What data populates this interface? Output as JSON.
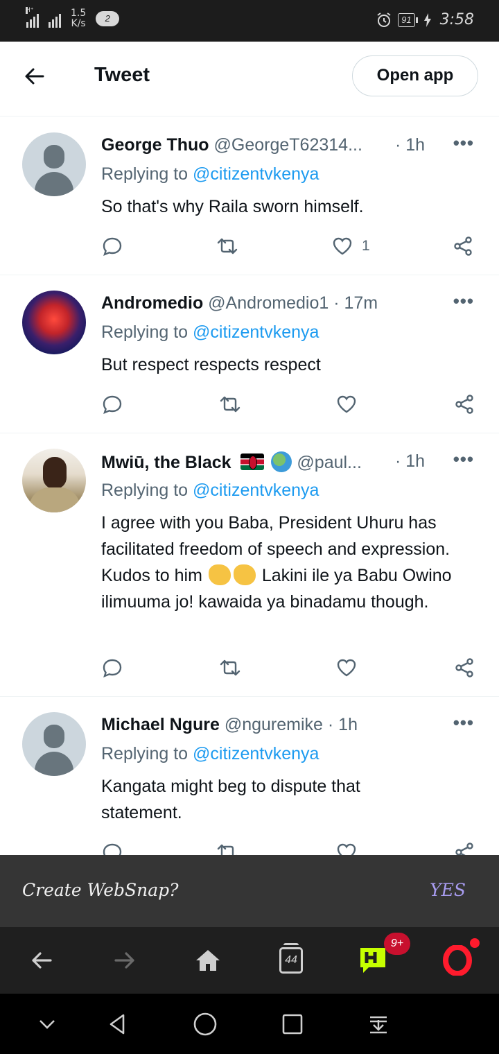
{
  "status_bar": {
    "network_speed": "1.5",
    "network_unit": "K/s",
    "signal1_label": "H⁺",
    "notification_count": "2",
    "battery_level": "91",
    "time": "3:58"
  },
  "header": {
    "title": "Tweet",
    "open_app_label": "Open app"
  },
  "tweets": [
    {
      "name": "George Thuo",
      "handle": "@GeorgeT62314...",
      "time": "· 1h",
      "replying_prefix": "Replying to ",
      "replying_to": "@citizentvkenya",
      "text": "So that's why Raila sworn himself.",
      "like_count": "1",
      "avatar": "default-avatar"
    },
    {
      "name": "Andromedio",
      "handle": "@Andromedio1",
      "time": "· 17m",
      "replying_prefix": "Replying to ",
      "replying_to": "@citizentvkenya",
      "text": "But respect respects respect",
      "like_count": "",
      "avatar": "planet-avatar"
    },
    {
      "name": "Mwiū, the Black",
      "handle": "@paul...",
      "time": "· 1h",
      "replying_prefix": "Replying to ",
      "replying_to": "@citizentvkenya",
      "text_part1": "I agree with you Baba, President Uhuru has facilitated freedom of speech and expression. Kudos to him",
      "text_part2": " Lakini ile ya Babu Owino ilimuuma jo! kawaida ya binadamu though.",
      "like_count": "",
      "avatar": "person-avatar"
    },
    {
      "name": "Michael Ngure",
      "handle": "@nguremike",
      "time": "· 1h",
      "replying_prefix": "Replying to ",
      "replying_to": "@citizentvkenya",
      "text": "Kangata might beg to dispute that statement.",
      "like_count": "",
      "avatar": "default-avatar"
    }
  ],
  "websnap": {
    "prompt": "Create WebSnap?",
    "yes_label": "YES"
  },
  "browser_bar": {
    "tab_count": "44",
    "hub_badge": "9+",
    "icons": [
      "back-arrow-icon",
      "forward-arrow-icon",
      "home-icon",
      "tabs-icon",
      "hub-icon",
      "opera-menu-icon"
    ]
  },
  "colors": {
    "link": "#1d9bf0",
    "secondary_text": "#536471",
    "websnap_yes": "#a89cf0",
    "opera_red": "#ff1b2d"
  }
}
